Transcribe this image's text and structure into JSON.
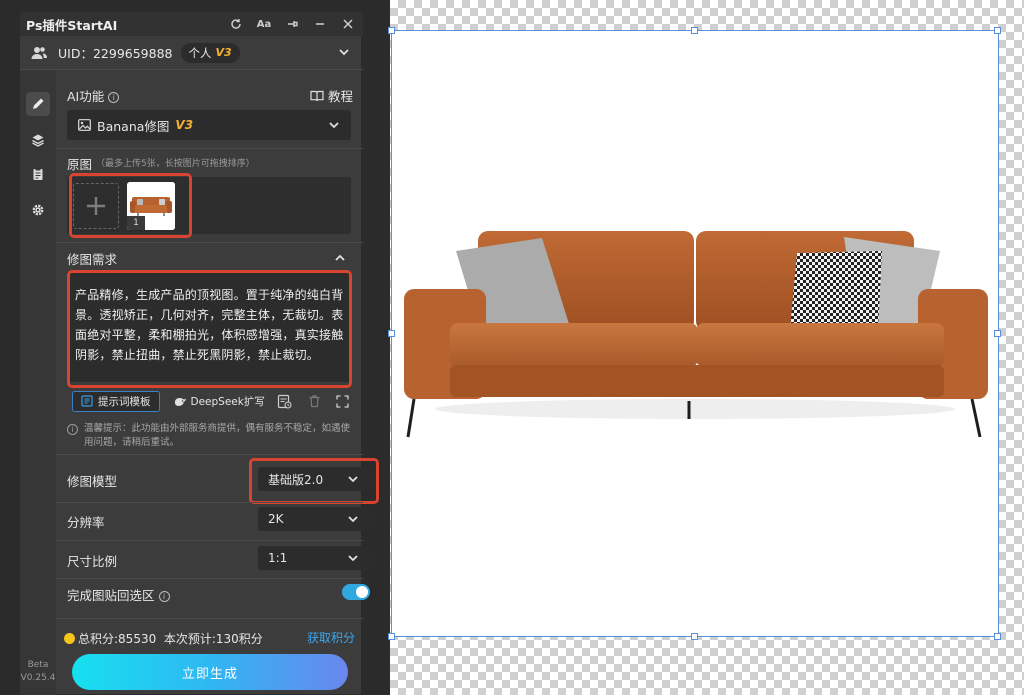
{
  "app": {
    "title": "Ps插件StartAI"
  },
  "user": {
    "uid_label": "UID：2299659888",
    "plan": "个人",
    "plan_version": "V3"
  },
  "ai": {
    "section_label": "AI功能",
    "tutorial_label": "教程",
    "function_name": "Banana修图",
    "function_version": "V3"
  },
  "source": {
    "label": "原图",
    "hint": "（最多上传5张，长按图片可拖拽排序）",
    "thumb_index": "1"
  },
  "prompt": {
    "label": "修图需求",
    "text": "产品精修，生成产品的顶视图。置于纯净的纯白背景。透视矫正，几何对齐，完整主体，无裁切。表面绝对平整，柔和棚拍光，体积感增强，真实接触阴影，禁止扭曲，禁止死黑阴影，禁止裁切。",
    "template_button": "提示词模板",
    "deepseek_button": "DeepSeek扩写"
  },
  "notice": {
    "text": "温馨提示：此功能由外部服务商提供，偶有服务不稳定，如遇使用问题，请稍后重试。"
  },
  "settings": {
    "model_label": "修图模型",
    "model_value": "基础版2.0",
    "resolution_label": "分辨率",
    "resolution_value": "2K",
    "ratio_label": "尺寸比例",
    "ratio_value": "1:1",
    "paste_back_label": "完成图贴回选区",
    "paste_back_enabled": true
  },
  "footer": {
    "points_text": "总积分:85530  本次预计:130积分",
    "get_points": "获取积分",
    "generate_button": "立即生成"
  },
  "sidebar": {
    "beta_label": "Beta",
    "version_label": "V0.25.4"
  },
  "colors": {
    "accent": "#2fa9e0",
    "highlight": "#d8442f",
    "version_gold": "#f2b233"
  }
}
